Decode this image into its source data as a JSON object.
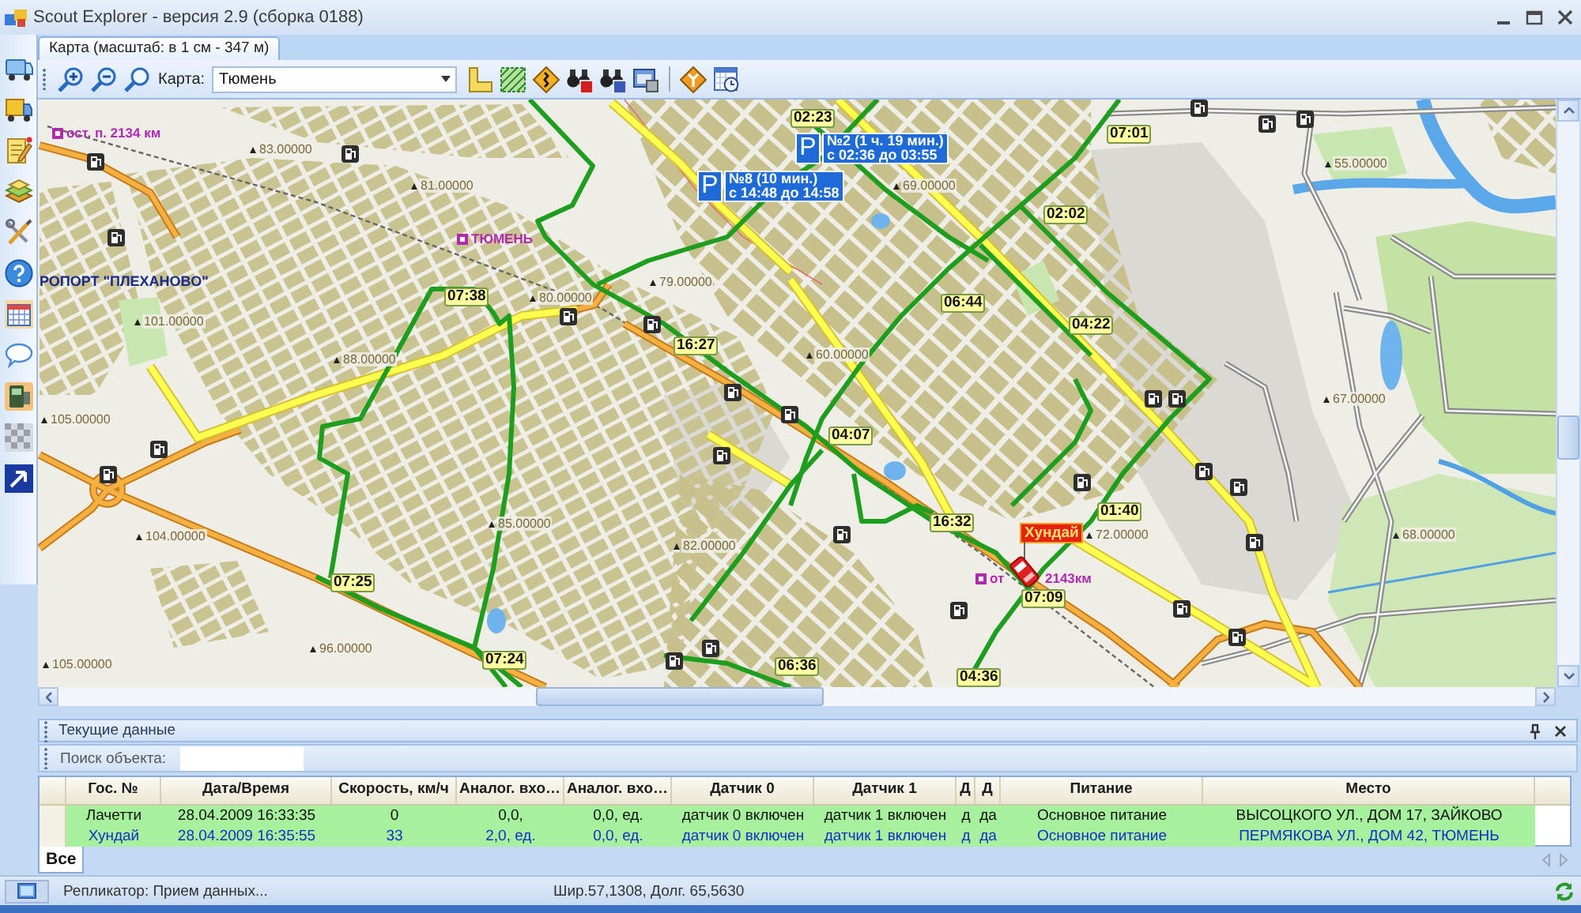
{
  "window": {
    "title": "Scout Explorer - версия 2.9 (сборка 0188)"
  },
  "tabs": [
    {
      "label": "Карта (масштаб: в 1 см - 347 м)",
      "selected": true
    }
  ],
  "toolbar": {
    "map_label": "Карта:",
    "map_value": "Тюмень"
  },
  "map": {
    "places": [
      {
        "kind": "stop",
        "text": "ост. п. 2134 км"
      },
      {
        "kind": "stop",
        "text": "ТЮМЕНЬ"
      },
      {
        "kind": "area",
        "text": "РОПОРТ \"ПЛЕХАНОВО\""
      },
      {
        "kind": "stop",
        "text": "от"
      },
      {
        "kind": "fragment",
        "text": "2143км"
      }
    ],
    "spot_heights": [
      "83.00000",
      "55.00000",
      "81.00000",
      "69.00000",
      "79.00000",
      "80.00000",
      "101.00000",
      "88.00000",
      "60.00000",
      "67.00000",
      "105.00000",
      "104.00000",
      "85.00000",
      "82.00000",
      "72.00000",
      "68.00000",
      "96.00000",
      "105.00000"
    ],
    "parkings": [
      {
        "sign": "P",
        "title": "№2 (1 ч. 19 мин.)",
        "period": "с 02:36 до 03:55"
      },
      {
        "sign": "P",
        "title": "№8 (10 мин.)",
        "period": "с 14:48 до 14:58"
      }
    ],
    "time_marks": [
      "02:23",
      "07:01",
      "02:02",
      "07:38",
      "06:44",
      "04:22",
      "16:27",
      "04:07",
      "16:32",
      "01:40",
      "07:25",
      "07:09",
      "07:24",
      "06:36",
      "04:36"
    ],
    "vehicle": {
      "label": "Хундай"
    }
  },
  "panel": {
    "title": "Текущие данные",
    "search_label": "Поиск объекта:",
    "table": {
      "columns": [
        "Гос. №",
        "Дата/Время",
        "Скорость, км/ч",
        "Аналог. вхо…",
        "Аналог. вхо…",
        "Датчик 0",
        "Датчик 1",
        "Д",
        "Д",
        "Питание",
        "Место"
      ],
      "rows": [
        {
          "selected": false,
          "cells": [
            "Лачетти",
            "28.04.2009 16:33:35",
            "0",
            "0,0,",
            "0,0, ед.",
            "датчик 0 включен",
            "датчик 1 включен",
            "д",
            "да",
            "Основное питание",
            "ВЫСОЦКОГО УЛ., ДОМ 17, ЗАЙКОВО"
          ]
        },
        {
          "selected": true,
          "cells": [
            "Хундай",
            "28.04.2009 16:35:55",
            "33",
            "2,0, ед.",
            "0,0, ед.",
            "датчик 0 включен",
            "датчик 1 включен",
            "д",
            "да",
            "Основное питание",
            "ПЕРМЯКОВА УЛ., ДОМ 42, ТЮМЕНЬ"
          ]
        }
      ]
    },
    "tabs": [
      {
        "label": "Все",
        "selected": true
      }
    ]
  },
  "status_bar": {
    "message": "Репликатор: Прием данных...",
    "coordinates": "Шир.57,1308, Долг. 65,5630"
  }
}
